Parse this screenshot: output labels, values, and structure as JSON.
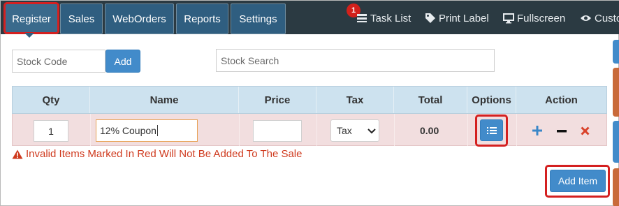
{
  "nav": {
    "tabs": [
      {
        "label": "Register",
        "active": true
      },
      {
        "label": "Sales"
      },
      {
        "label": "WebOrders"
      },
      {
        "label": "Reports"
      },
      {
        "label": "Settings"
      }
    ],
    "task_count": "1",
    "task_list": "Task List",
    "print_label": "Print Label",
    "fullscreen": "Fullscreen",
    "customer": "Custo"
  },
  "entry": {
    "stock_code_placeholder": "Stock Code",
    "add_label": "Add",
    "stock_search_placeholder": "Stock Search"
  },
  "table": {
    "headers": {
      "qty": "Qty",
      "name": "Name",
      "price": "Price",
      "tax": "Tax",
      "total": "Total",
      "options": "Options",
      "action": "Action"
    },
    "row": {
      "qty": "1",
      "name": "12% Coupon",
      "price": "",
      "tax": "Tax",
      "total": "0.00"
    }
  },
  "error_message": "Invalid Items Marked In Red Will Not Be Added To The Sale",
  "add_item_label": "Add Item",
  "colors": {
    "nav_bg": "#2b3a42",
    "tab_bg": "#2f5e80",
    "accent_blue": "#428bca",
    "highlight_red": "#d42020",
    "row_invalid": "#f2dedf",
    "header_bg": "#cde2ef",
    "error_text": "#cf3a1e"
  }
}
